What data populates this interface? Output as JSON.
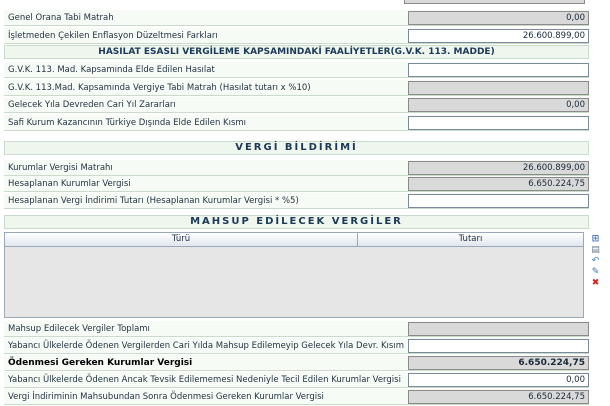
{
  "rows_top": [
    {
      "label": "Genel Orana Tabi Matrah",
      "value": "0,00"
    },
    {
      "label": "İşletmeden Çekilen Enflasyon Düzeltmesi Farkları",
      "value": "26.600.899,00"
    }
  ],
  "hasilat": {
    "header": "HASILAT ESASLI VERGİLEME KAPSAMINDAKİ FAALİYETLER(G.V.K. 113. MADDE)",
    "rows": [
      {
        "label": "G.V.K. 113. Mad. Kapsamında Elde Edilen Hasılat",
        "value": ""
      },
      {
        "label": "G.V.K. 113.Mad. Kapsamında Vergiye Tabi Matrah (Hasılat tutarı x %10)",
        "value": ""
      },
      {
        "label": "Gelecek Yıla Devreden Cari Yıl Zararları",
        "value": "0,00"
      },
      {
        "label": "Safi Kurum Kazancının Türkiye Dışında Elde Edilen Kısmı",
        "value": ""
      }
    ]
  },
  "vergi_bildirimi": {
    "header": "VERGİ BİLDİRİMİ",
    "rows": [
      {
        "label": "Kurumlar Vergisi Matrahı",
        "value": "26.600.899,00"
      },
      {
        "label": "Hesaplanan Kurumlar Vergisi",
        "value": "6.650.224,75"
      },
      {
        "label": "Hesaplanan Vergi İndirimi Tutarı (Hesaplanan Kurumlar Vergisi * %5)",
        "value": ""
      }
    ]
  },
  "mahsup": {
    "header": "MAHSUP EDİLECEK VERGİLER",
    "columns": [
      "Türü",
      "Tutarı"
    ],
    "rows": [
      {
        "label": "Mahsup Edilecek Vergiler Toplamı",
        "value": ""
      },
      {
        "label": "Yabancı Ülkelerde Ödenen Vergilerden Cari Yılda Mahsup Edilemeyip Gelecek Yıla Devr. Kısım",
        "value": ""
      },
      {
        "label": "Ödenmesi Gereken Kurumlar Vergisi",
        "value": "6.650.224,75"
      },
      {
        "label": "Yabancı Ülkelerde Ödenen Ancak Tevsik Edilememesi Nedeniyle Tecil Edilen Kurumlar Vergisi",
        "value": "0,00"
      },
      {
        "label": "Vergi İndiriminin Mahsubundan Sonra Ödenmesi Gereken Kurumlar Vergisi",
        "value": "6.650.224,75"
      }
    ]
  },
  "grid_tools": [
    "add-row-icon",
    "insert-row-icon",
    "undo-icon",
    "edit-row-icon",
    "delete-row-icon"
  ],
  "colors": {
    "readonly_field": "#d9d9d9",
    "header_text": "#1c3a58",
    "delete": "#d42020"
  }
}
